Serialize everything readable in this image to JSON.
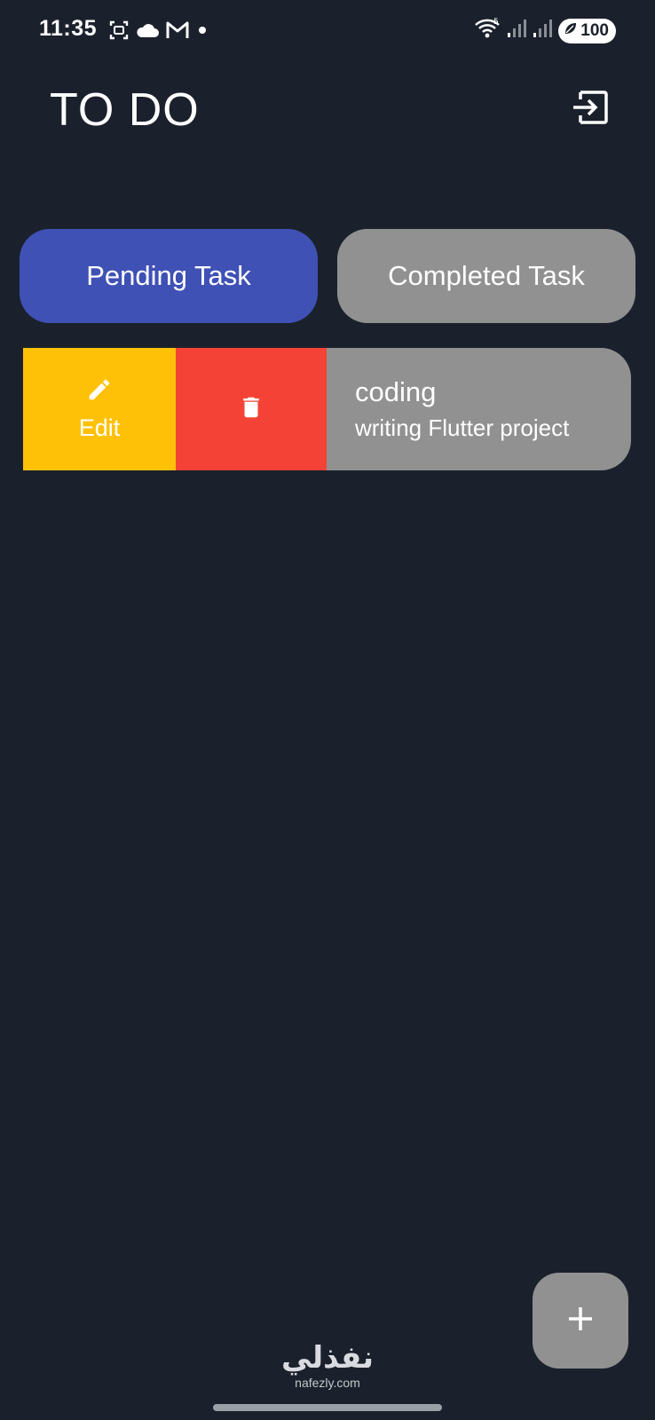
{
  "status_bar": {
    "time": "11:35",
    "battery": "100",
    "left_icons": [
      "screenshot-icon",
      "cloud-icon",
      "gmail-icon",
      "dot-icon"
    ],
    "right_icons": [
      "wifi-icon",
      "signal-icon",
      "signal-icon",
      "battery-icon"
    ]
  },
  "header": {
    "title": "TO DO",
    "logout_icon": "logout-icon"
  },
  "tabs": [
    {
      "label": "Pending Task",
      "active": true
    },
    {
      "label": "Completed Task",
      "active": false
    }
  ],
  "tasks": [
    {
      "title": "coding",
      "description": "writing Flutter project",
      "actions": {
        "edit_label": "Edit",
        "edit_icon": "pencil-icon",
        "delete_icon": "trash-icon"
      }
    }
  ],
  "fab": {
    "icon": "plus-icon"
  },
  "watermark": {
    "arabic": "نفذلي",
    "latin": "nafezly.com"
  },
  "colors": {
    "background": "#1b212c",
    "tab_active": "#3f51b5",
    "tab_inactive": "#919191",
    "edit": "#ffc107",
    "delete": "#f44336",
    "card": "#919191",
    "fab": "#919191"
  }
}
